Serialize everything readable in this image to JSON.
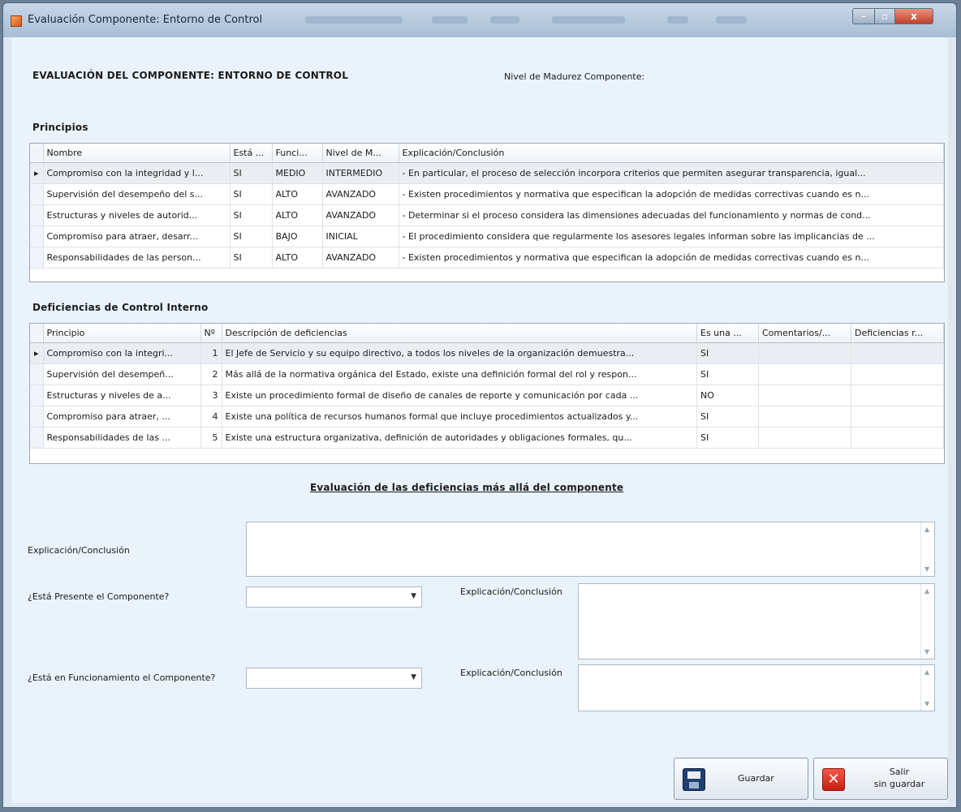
{
  "window": {
    "title": "Evaluación Componente: Entorno de Control",
    "controls": {
      "minimize": "–",
      "maximize": "▫",
      "close": "x"
    }
  },
  "header": {
    "title": "EVALUACIÓN DEL COMPONENTE: ENTORNO DE CONTROL",
    "maturity_label": "Nivel de Madurez Componente:"
  },
  "principios": {
    "section_title": "Principios",
    "columns": [
      "Nombre",
      "Está ...",
      "Funci...",
      "Nivel de M...",
      "Explicación/Conclusión"
    ],
    "rows": [
      [
        "Compromiso con la integridad y l...",
        "SI",
        "MEDIO",
        "INTERMEDIO",
        "- En particular, el proceso de selección incorpora criterios que permiten asegurar transparencia, igual..."
      ],
      [
        "Supervisión del desempeño del s...",
        "SI",
        "ALTO",
        "AVANZADO",
        "- Existen procedimientos y normativa que especifican la adopción de medidas correctivas cuando es n..."
      ],
      [
        "Estructuras y niveles de autorid...",
        "SI",
        "ALTO",
        "AVANZADO",
        "- Determinar si el proceso considera las dimensiones adecuadas del funcionamiento y normas de cond..."
      ],
      [
        "Compromiso para atraer, desarr...",
        "SI",
        "BAJO",
        "INICIAL",
        "- El procedimiento considera que regularmente los asesores legales informan sobre las implicancias de ..."
      ],
      [
        "Responsabilidades de las person...",
        "SI",
        "ALTO",
        "AVANZADO",
        "- Existen procedimientos y normativa que especifican la adopción de medidas correctivas cuando es n..."
      ]
    ]
  },
  "deficiencias": {
    "section_title": "Deficiencias de Control Interno",
    "columns": [
      "Principio",
      "Nº",
      "Descripción de deficiencias",
      "Es una ...",
      "Comentarios/...",
      "Deficiencias r..."
    ],
    "rows": [
      [
        "Compromiso con la integri...",
        "1",
        "El Jefe de Servicio y su equipo directivo, a todos los niveles de la organización demuestra...",
        "SI",
        "",
        ""
      ],
      [
        "Supervisión del desempeñ...",
        "2",
        "Más allá de la normativa orgánica del Estado, existe una definición formal del rol y respon...",
        "SI",
        "",
        ""
      ],
      [
        "Estructuras y niveles de a...",
        "3",
        "Existe un procedimiento formal de diseño de canales de reporte y comunicación por cada ...",
        "NO",
        "",
        ""
      ],
      [
        "Compromiso para atraer, ...",
        "4",
        "Existe una política de recursos humanos formal que incluye procedimientos actualizados y...",
        "SI",
        "",
        ""
      ],
      [
        "Responsabilidades de las ...",
        "5",
        "Existe una estructura organizativa, definición de autoridades y obligaciones formales, qu...",
        "SI",
        "",
        ""
      ]
    ]
  },
  "evaluacion": {
    "title": "Evaluación de las deficiencias más allá del componente",
    "explicacion_label": "Explicación/Conclusión",
    "explicacion_value": "",
    "presente_label": "¿Está Presente el Componente?",
    "presente_value": "",
    "presente_expl_label": "Explicación/Conclusión",
    "presente_expl_value": "",
    "funcionamiento_label": "¿Está en Funcionamiento el Componente?",
    "funcionamiento_value": "",
    "funcionamiento_expl_label": "Explicación/Conclusión",
    "funcionamiento_expl_value": ""
  },
  "buttons": {
    "save": "Guardar",
    "exit_line1": "Salir",
    "exit_line2": "sin guardar"
  },
  "icons": {
    "app": "app-icon",
    "row_indicator": "current-row-arrow-icon",
    "dropdown": "chevron-down-icon",
    "save": "floppy-disk-icon",
    "exit": "red-x-icon"
  }
}
